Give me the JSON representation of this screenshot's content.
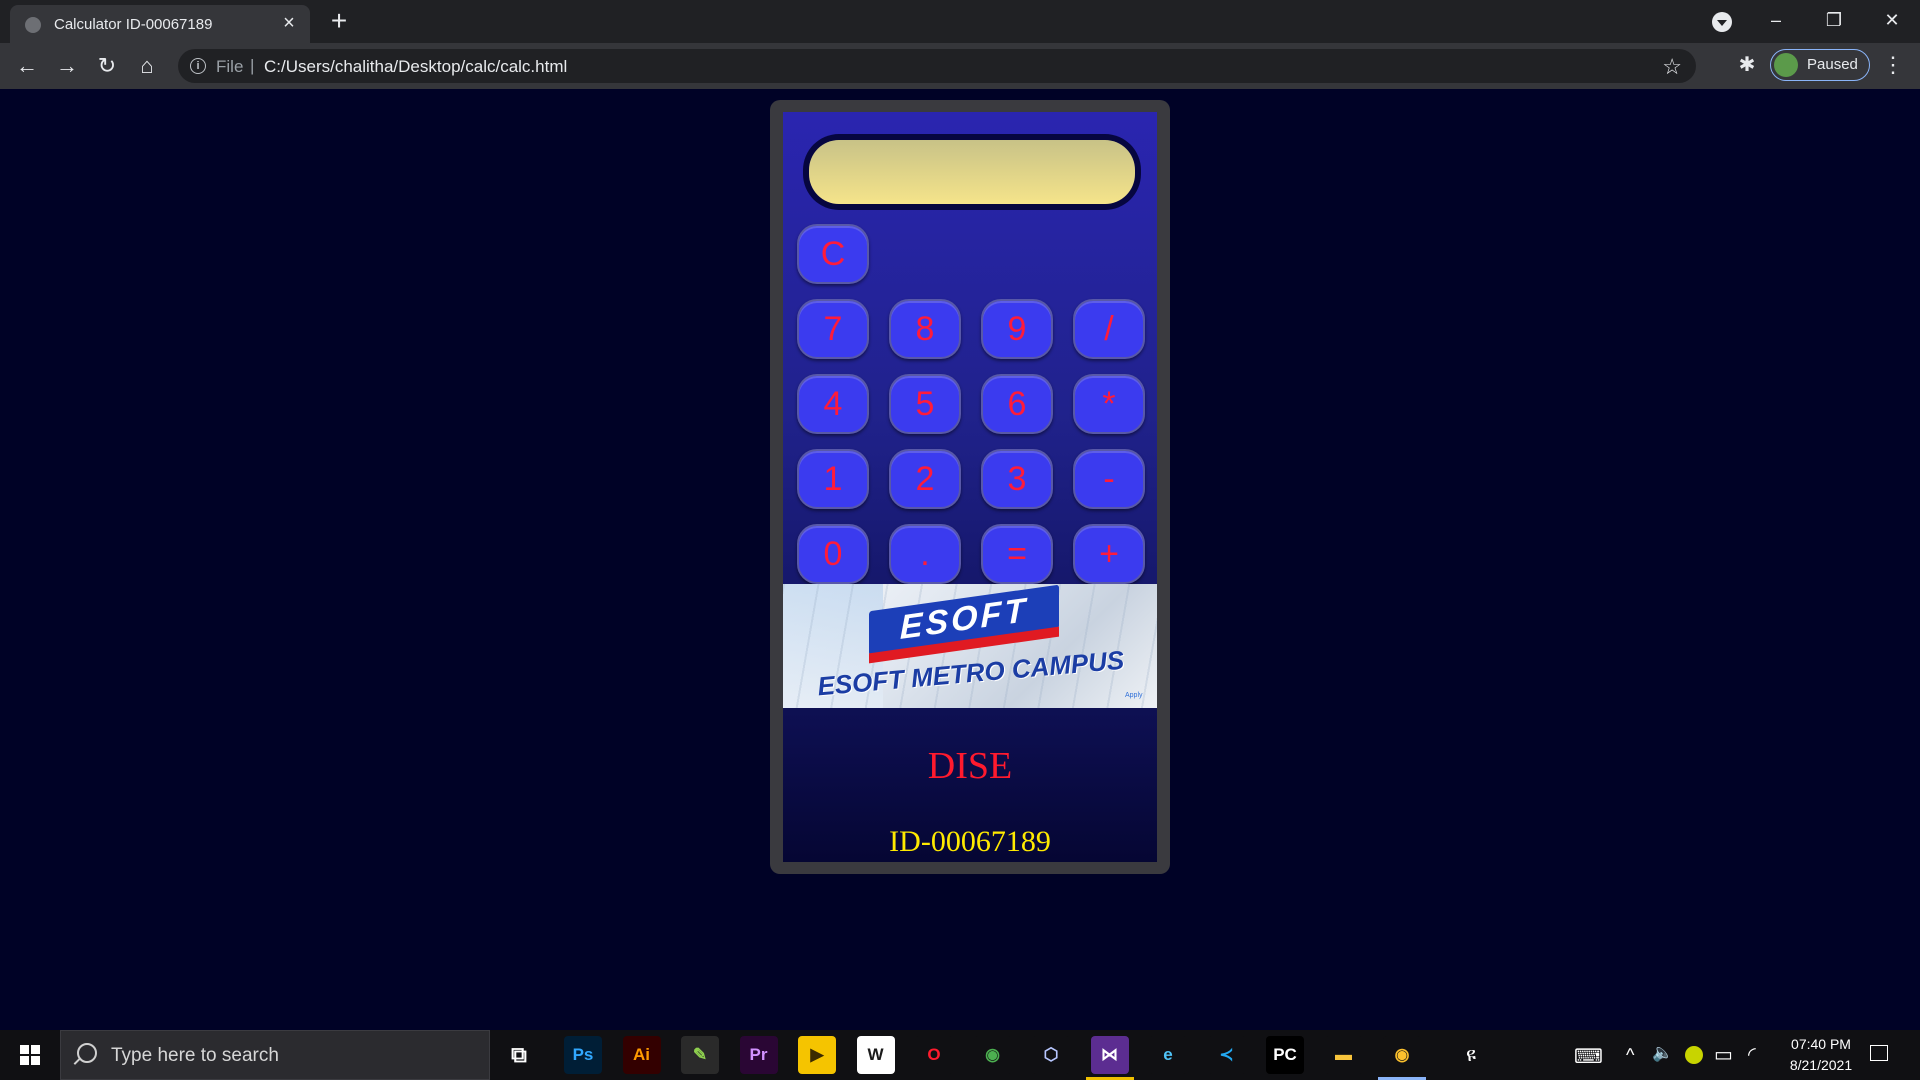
{
  "browser": {
    "tab_title": "Calculator ID-00067189",
    "new_tab": "+",
    "url_scheme": "File",
    "url_separator": "|",
    "url": "C:/Users/chalitha/Desktop/calc/calc.html",
    "profile_status": "Paused",
    "window_controls": {
      "minimize": "–",
      "restore": "❐",
      "close": "✕"
    },
    "icons": {
      "back": "←",
      "forward": "→",
      "reload": "↻",
      "home": "⌂",
      "info": "i",
      "star": "☆",
      "extensions": "✱",
      "menu": "⋮",
      "tab_close": "×"
    }
  },
  "calculator": {
    "display_value": "",
    "clear": "C",
    "rows": [
      [
        "7",
        "8",
        "9",
        "/"
      ],
      [
        "4",
        "5",
        "6",
        "*"
      ],
      [
        "1",
        "2",
        "3",
        "-"
      ],
      [
        "0",
        ".",
        "=",
        "+"
      ]
    ],
    "banner": {
      "logo": "ESOFT",
      "caption": "ESOFT METRO CAMPUS",
      "apply": "Apply"
    },
    "course": "DISE",
    "student_id": "ID-00067189"
  },
  "taskbar": {
    "search_placeholder": "Type here to search",
    "apps": [
      {
        "name": "photoshop",
        "label": "Ps",
        "color": "#31a8ff",
        "bg": "#001e36"
      },
      {
        "name": "illustrator",
        "label": "Ai",
        "color": "#ff9a00",
        "bg": "#330000"
      },
      {
        "name": "notepad-plus",
        "label": "✎",
        "color": "#8fd14f",
        "bg": "#2a2a2a"
      },
      {
        "name": "premiere",
        "label": "Pr",
        "color": "#d291ff",
        "bg": "#2a0634"
      },
      {
        "name": "media-player",
        "label": "▶",
        "color": "#3a2a00",
        "bg": "#f5c400"
      },
      {
        "name": "wps",
        "label": "W",
        "color": "#1b1b1b",
        "bg": "#ffffff"
      },
      {
        "name": "opera",
        "label": "O",
        "color": "#ff1b2d",
        "bg": "#101013"
      },
      {
        "name": "chrome",
        "label": "◉",
        "color": "#4caf50",
        "bg": "#101013"
      },
      {
        "name": "virtualbox",
        "label": "⬡",
        "color": "#b8c7ff",
        "bg": "#101013"
      },
      {
        "name": "visual-studio",
        "label": "⋈",
        "color": "#ffffff",
        "bg": "#5c2d91"
      },
      {
        "name": "edge",
        "label": "e",
        "color": "#4fc3f7",
        "bg": "#101013"
      },
      {
        "name": "vscode",
        "label": "≺",
        "color": "#23a9f2",
        "bg": "#101013"
      },
      {
        "name": "pycharm",
        "label": "PC",
        "color": "#ffffff",
        "bg": "#000000"
      },
      {
        "name": "file-explorer",
        "label": "▬",
        "color": "#f8c43c",
        "bg": "#101013"
      },
      {
        "name": "chrome-active",
        "label": "◉",
        "color": "#fbc02d",
        "bg": "#101013"
      }
    ],
    "people": "ዩ",
    "clock_time": "07:40 PM",
    "clock_date": "8/21/2021",
    "tray": {
      "keyboard": "⌨",
      "chevron": "^",
      "volume": "🔈",
      "battery": "▭",
      "wifi": "◜"
    }
  },
  "colors": {
    "page_bg": "#000226",
    "key_bg": "#3b3bef",
    "key_text": "#ff1b3a",
    "display_bg": "#f5e48a",
    "course_text": "#ff1a2e",
    "id_text": "#ffea00"
  }
}
